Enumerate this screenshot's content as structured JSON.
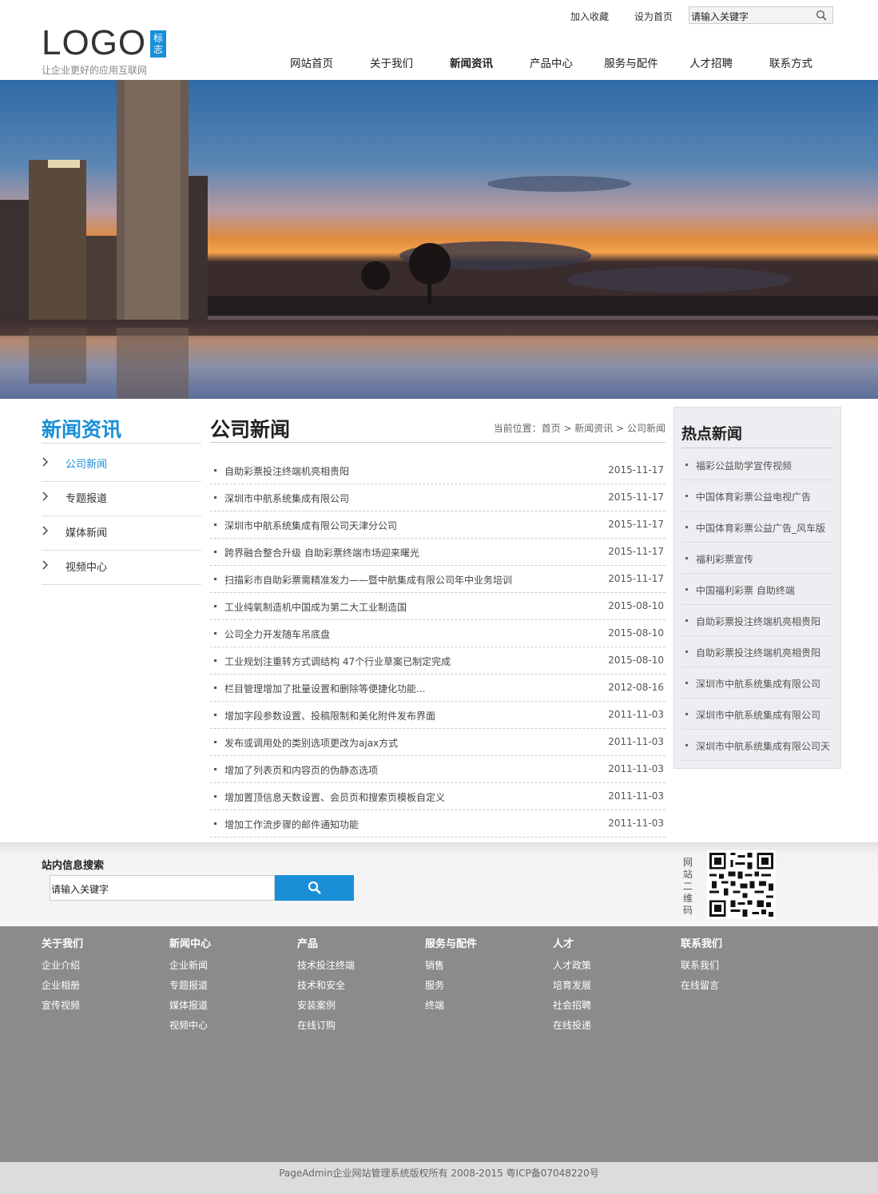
{
  "header": {
    "logo_text": "LOGO",
    "logo_mark": "标志",
    "slogan": "让企业更好的应用互联网",
    "top_links": [
      "加入收藏",
      "设为首页"
    ],
    "search_placeholder": "请输入关键字",
    "nav": [
      "网站首页",
      "关于我们",
      "新闻资讯",
      "产品中心",
      "服务与配件",
      "人才招聘",
      "联系方式"
    ],
    "active_nav": "新闻资讯"
  },
  "banner": {
    "slide_count": 3,
    "active_slide": 1
  },
  "left_sidebar": {
    "title": "新闻资讯",
    "items": [
      "公司新闻",
      "专题报道",
      "媒体新闻",
      "视频中心"
    ],
    "active_item": "公司新闻"
  },
  "main": {
    "title": "公司新闻",
    "breadcrumb": "当前位置：首页 > 新闻资讯 > 公司新闻",
    "news": [
      {
        "title": "自助彩票投注终端机亮相贵阳",
        "date": "2015-11-17"
      },
      {
        "title": "深圳市中航系统集成有限公司",
        "date": "2015-11-17"
      },
      {
        "title": "深圳市中航系统集成有限公司天津分公司",
        "date": "2015-11-17"
      },
      {
        "title": "跨界融合整合升级 自助彩票终端市场迎来曙光",
        "date": "2015-11-17"
      },
      {
        "title": "扫描彩市自助彩票需精准发力——暨中航集成有限公司年中业务培训",
        "date": "2015-11-17"
      },
      {
        "title": "工业纯氧制造机中国成为第二大工业制造国",
        "date": "2015-08-10"
      },
      {
        "title": "公司全力开发随车吊底盘",
        "date": "2015-08-10"
      },
      {
        "title": "工业规划注重转方式调结构 47个行业草案已制定完成",
        "date": "2015-08-10"
      },
      {
        "title": "栏目管理增加了批量设置和删除等便捷化功能...",
        "date": "2012-08-16"
      },
      {
        "title": "增加字段参数设置、投稿限制和美化附件发布界面",
        "date": "2011-11-03"
      },
      {
        "title": "发布或调用处的类别选项更改为ajax方式",
        "date": "2011-11-03"
      },
      {
        "title": "增加了列表页和内容页的伪静态选项",
        "date": "2011-11-03"
      },
      {
        "title": "增加置顶信息天数设置、会员页和搜索页模板自定义",
        "date": "2011-11-03"
      },
      {
        "title": "增加工作流步骤的邮件通知功能",
        "date": "2011-11-03"
      }
    ]
  },
  "hot_news": {
    "title": "热点新闻",
    "items": [
      "福彩公益助学宣传视频",
      "中国体育彩票公益电视广告",
      "中国体育彩票公益广告_风车版",
      "福利彩票宣传",
      "中国福利彩票 自助终端",
      "自助彩票投注终端机亮相贵阳",
      "自助彩票投注终端机亮相贵阳",
      "深圳市中航系统集成有限公司",
      "深圳市中航系统集成有限公司",
      "深圳市中航系统集成有限公司天"
    ]
  },
  "site_search": {
    "title": "站内信息搜索",
    "placeholder": "请输入关键字",
    "qr_label": "网站二维码"
  },
  "footer": {
    "columns": [
      {
        "head": "关于我们",
        "links": [
          "企业介绍",
          "企业相册",
          "宣传视频"
        ]
      },
      {
        "head": "新闻中心",
        "links": [
          "企业新闻",
          "专题报道",
          "媒体报道",
          "视频中心"
        ]
      },
      {
        "head": "产品",
        "links": [
          "技术投注终端",
          "技术和安全",
          "安装案例",
          "在线订购"
        ]
      },
      {
        "head": "服务与配件",
        "links": [
          "销售",
          "服务",
          "终端"
        ]
      },
      {
        "head": "人才",
        "links": [
          "人才政策",
          "培育发展",
          "社会招聘",
          "在线投递"
        ]
      },
      {
        "head": "联系我们",
        "links": [
          "联系我们",
          "在线留言"
        ]
      }
    ],
    "copyright": "PageAdmin企业网站管理系统版权所有 2008-2015 粤ICP备07048220号"
  },
  "colors": {
    "accent": "#1a8fd8",
    "footer_bg": "#8b8b8d",
    "hot_box_bg": "#eeedf1"
  }
}
